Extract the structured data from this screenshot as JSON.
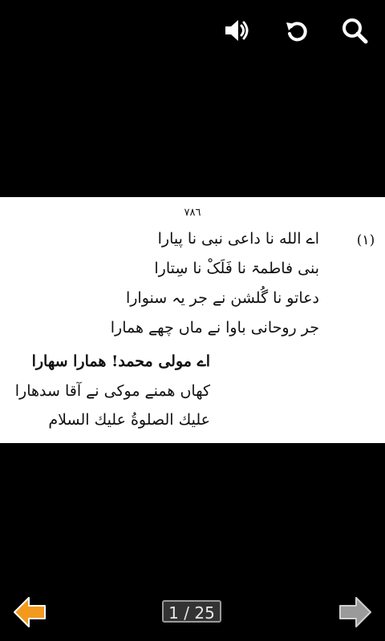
{
  "toolbar": {
    "icons": [
      "volume-icon",
      "rotate-icon",
      "search-icon"
    ]
  },
  "page": {
    "page_number": "٧٨٦",
    "verse_number": "(١)",
    "stanza": [
      "اے الله نا داعی نبی نا پیارا",
      "بنی فاطمۃ نا فَلَکْ نا سِتارا",
      "دعاتو نا گُلشن نے جر یہ سنوارا",
      "جر روحانی باوا نے ماں چھے ھمارا"
    ],
    "chorus": [
      "اے مولی محمد! ھمارا سھارا",
      "کھاں ھمنے موکی نے آقا سدھارا",
      "علیك الصلوةُ علیك السلام"
    ]
  },
  "pagination": {
    "current": 1,
    "total": 25,
    "label": "1 / 25"
  },
  "colors": {
    "prev_arrow": "#f39a1e",
    "next_arrow": "#9a9a9a",
    "background": "#000000",
    "page": "#ffffff"
  }
}
